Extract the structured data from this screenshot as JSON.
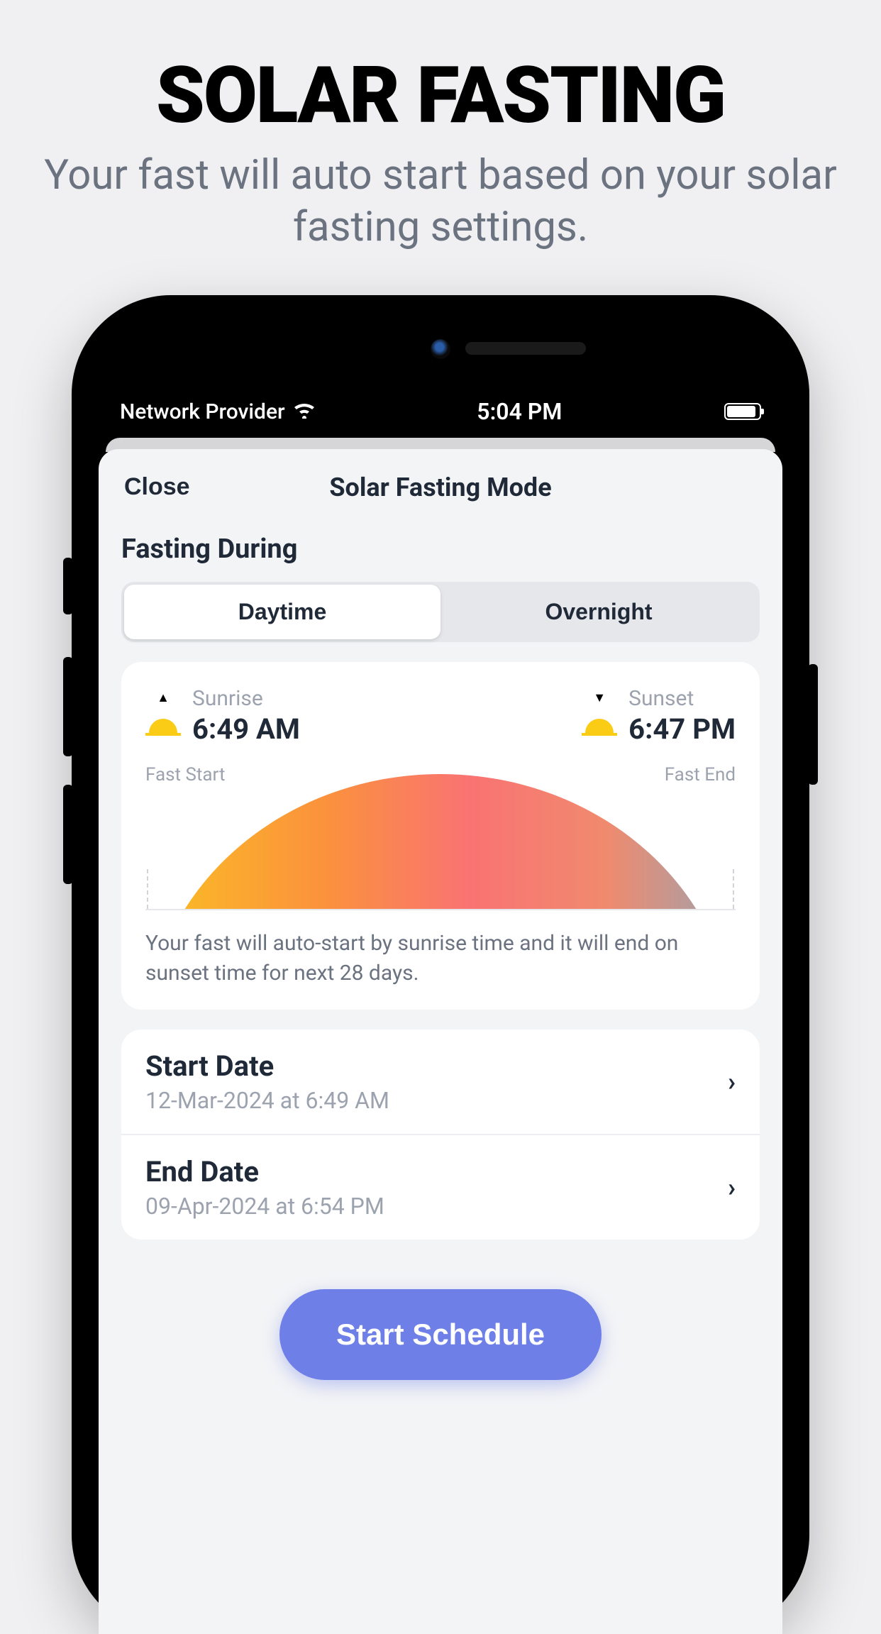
{
  "promo": {
    "title": "SOLAR FASTING",
    "subtitle": "Your fast will auto start based on your solar fasting settings."
  },
  "statusBar": {
    "carrier": "Network Provider",
    "time": "5:04 PM"
  },
  "nav": {
    "close": "Close",
    "title": "Solar Fasting Mode"
  },
  "fasting": {
    "label": "Fasting During",
    "tabs": {
      "daytime": "Daytime",
      "overnight": "Overnight"
    }
  },
  "sun": {
    "sunriseLabel": "Sunrise",
    "sunriseTime": "6:49 AM",
    "sunsetLabel": "Sunset",
    "sunsetTime": "6:47 PM",
    "fastStart": "Fast Start",
    "fastEnd": "Fast End",
    "note": "Your fast will auto-start by sunrise time and it will end on sunset time for next 28 days."
  },
  "dates": {
    "startTitle": "Start Date",
    "startValue": "12-Mar-2024 at 6:49 AM",
    "endTitle": "End Date",
    "endValue": "09-Apr-2024 at 6:54 PM"
  },
  "cta": "Start Schedule"
}
